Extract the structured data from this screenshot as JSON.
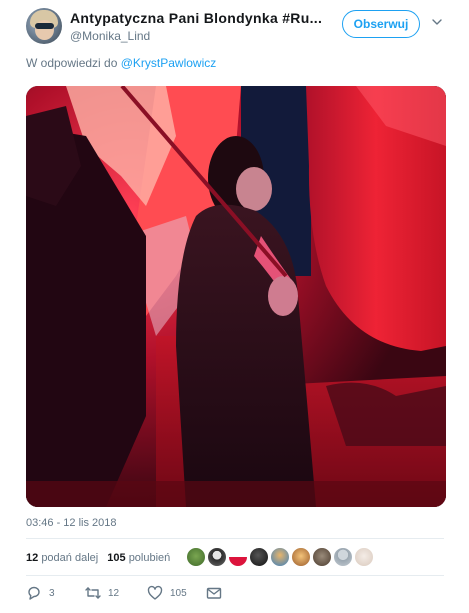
{
  "author": {
    "display_name": "Antypatyczna Pani Blondynka #Ru...",
    "handle": "@Monika_Lind"
  },
  "follow_button": "Obserwuj",
  "reply": {
    "prefix": "W odpowiedzi do",
    "mention": "@KrystPawlowicz"
  },
  "timestamp": "03:46 - 12 lis 2018",
  "stats": {
    "retweets_count": "12",
    "retweets_label": "podań dalej",
    "likes_count": "105",
    "likes_label": "polubień"
  },
  "actions": {
    "reply_count": "3",
    "retweet_count": "12",
    "like_count": "105"
  },
  "colors": {
    "accent": "#1da1f2",
    "secondary_text": "#657786",
    "divider": "#e6ecf0"
  }
}
